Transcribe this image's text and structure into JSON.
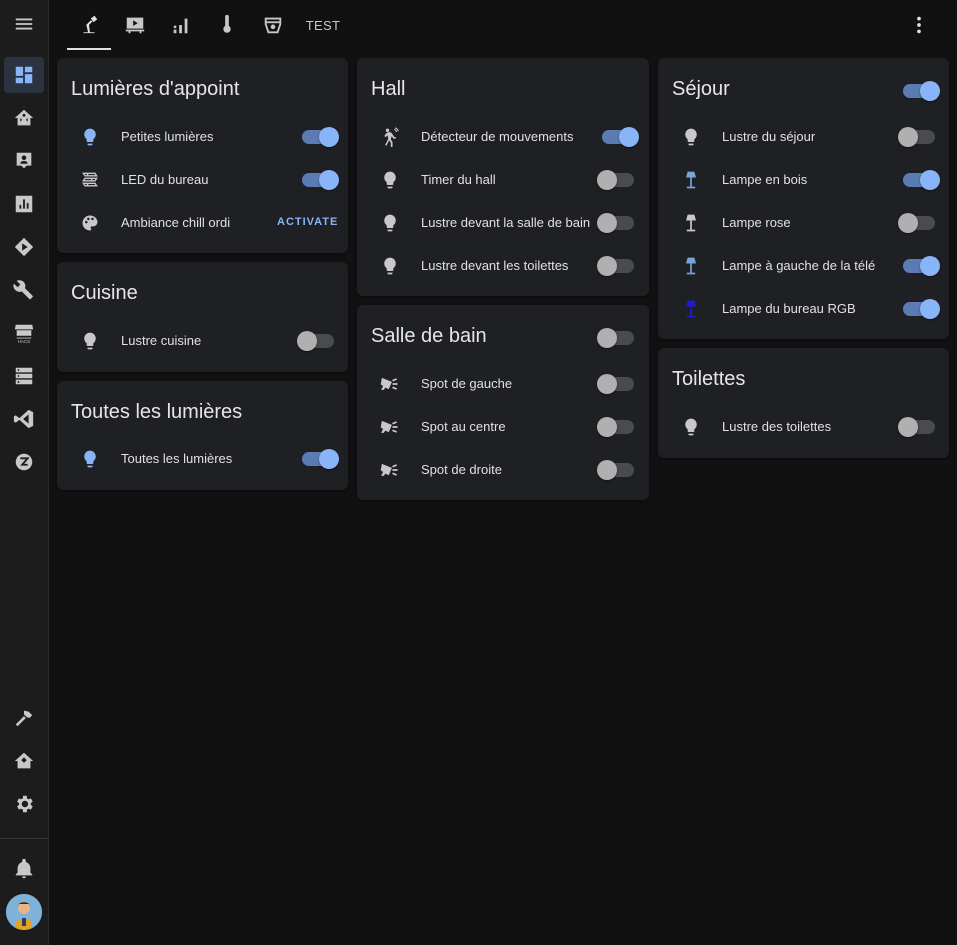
{
  "colors": {
    "accent": "#8ab4f8",
    "toggle_on_track": "#5b7bb3",
    "card_bg": "#1f2023",
    "page_bg": "#111111"
  },
  "sidebar": {
    "items": [
      {
        "icon": "menu-icon"
      },
      {
        "icon": "dashboard-icon"
      },
      {
        "icon": "home-assistant-icon"
      },
      {
        "icon": "account-box-icon"
      },
      {
        "icon": "chart-box-icon"
      },
      {
        "icon": "node-red-icon"
      },
      {
        "icon": "wrench-icon"
      },
      {
        "icon": "hacs-store-icon"
      },
      {
        "icon": "server-icon"
      },
      {
        "icon": "vscode-icon"
      },
      {
        "icon": "zwave-icon"
      },
      {
        "icon": "hammer-icon"
      },
      {
        "icon": "home-automation-icon"
      },
      {
        "icon": "gear-icon"
      },
      {
        "icon": "bell-icon"
      },
      {
        "icon": "avatar"
      }
    ]
  },
  "header": {
    "tabs": [
      {
        "icon": "desk-lamp-icon"
      },
      {
        "icon": "projector-screen-icon"
      },
      {
        "icon": "signal-bars-icon"
      },
      {
        "icon": "thermometer-icon"
      },
      {
        "icon": "robot-vacuum-icon"
      },
      {
        "label": "TEST"
      }
    ],
    "menu_icon": "dots-vertical-icon"
  },
  "cards": {
    "lumieres": {
      "title": "Lumières d'appoint",
      "rows": [
        {
          "label": "Petites lumières",
          "icon": "bulb-icon",
          "state": "on"
        },
        {
          "label": "LED du bureau",
          "icon": "led-strip-icon",
          "state": "on"
        },
        {
          "label": "Ambiance chill ordi",
          "icon": "palette-icon",
          "action": "ACTIVATE"
        }
      ]
    },
    "cuisine": {
      "title": "Cuisine",
      "rows": [
        {
          "label": "Lustre cuisine",
          "icon": "bulb-icon",
          "state": "off"
        }
      ]
    },
    "toutes": {
      "title": "Toutes les lumières",
      "rows": [
        {
          "label": "Toutes les lumières",
          "icon": "bulb-icon",
          "state": "on"
        }
      ]
    },
    "hall": {
      "title": "Hall",
      "rows": [
        {
          "label": "Détecteur de mouvements",
          "icon": "motion-sensor-icon",
          "state": "on"
        },
        {
          "label": "Timer du hall",
          "icon": "bulb-icon",
          "state": "off"
        },
        {
          "label": "Lustre devant la salle de bain",
          "icon": "bulb-icon",
          "state": "off"
        },
        {
          "label": "Lustre devant les toilettes",
          "icon": "bulb-icon",
          "state": "off"
        }
      ]
    },
    "sdb": {
      "title": "Salle de bain",
      "header_state": "off",
      "rows": [
        {
          "label": "Spot de gauche",
          "icon": "spotlight-icon",
          "state": "off"
        },
        {
          "label": "Spot au centre",
          "icon": "spotlight-icon",
          "state": "off"
        },
        {
          "label": "Spot de droite",
          "icon": "spotlight-icon",
          "state": "off"
        }
      ]
    },
    "sejour": {
      "title": "Séjour",
      "header_state": "on",
      "rows": [
        {
          "label": "Lustre du séjour",
          "icon": "bulb-icon",
          "state": "off"
        },
        {
          "label": "Lampe en bois",
          "icon": "floor-lamp-icon",
          "state": "on"
        },
        {
          "label": "Lampe rose",
          "icon": "floor-lamp-icon",
          "state": "off"
        },
        {
          "label": "Lampe à gauche de la télé",
          "icon": "floor-lamp-icon",
          "state": "on"
        },
        {
          "label": "Lampe du bureau RGB",
          "icon": "floor-lamp-icon",
          "state": "on"
        }
      ]
    },
    "toilettes": {
      "title": "Toilettes",
      "rows": [
        {
          "label": "Lustre des toilettes",
          "icon": "bulb-icon",
          "state": "off"
        }
      ]
    }
  }
}
